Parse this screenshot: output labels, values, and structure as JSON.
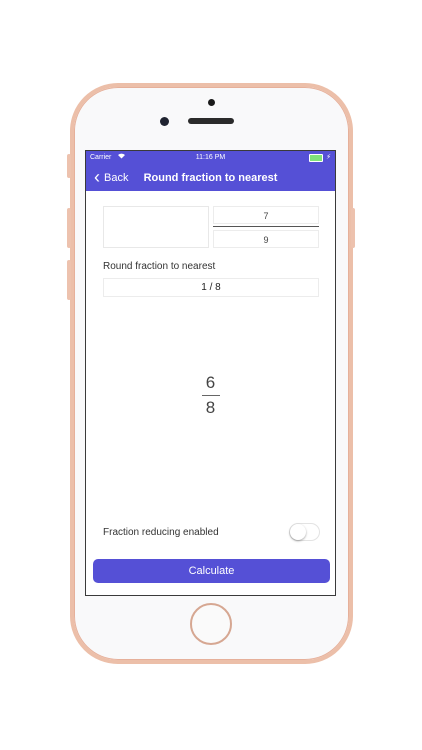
{
  "status_bar": {
    "carrier": "Carrier",
    "time": "11:16 PM"
  },
  "nav": {
    "back_label": "Back",
    "title": "Round fraction to nearest"
  },
  "input": {
    "whole": "",
    "numerator": "7",
    "denominator": "9"
  },
  "rounding": {
    "label": "Round fraction to nearest",
    "value": "1 / 8"
  },
  "result": {
    "numerator": "6",
    "denominator": "8"
  },
  "reduce": {
    "label": "Fraction reducing enabled",
    "enabled": false
  },
  "actions": {
    "calculate_label": "Calculate"
  },
  "colors": {
    "accent": "#5550d6",
    "phone_frame": "#ecbfa9",
    "battery": "#7fe27a"
  }
}
